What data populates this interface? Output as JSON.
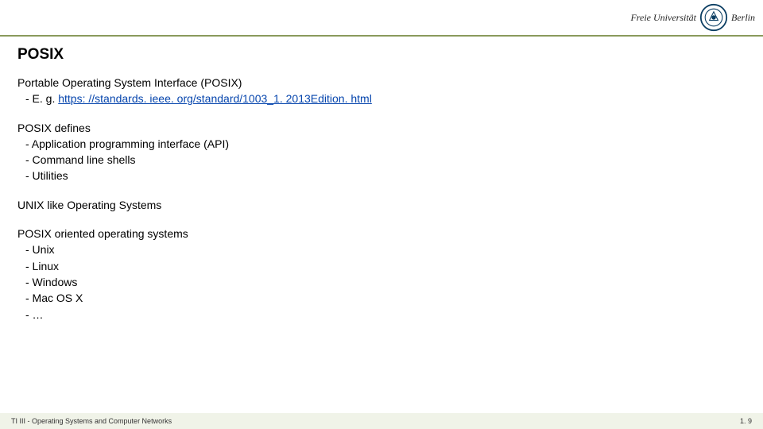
{
  "header": {
    "logo_left": "Freie Universität",
    "logo_right": "Berlin"
  },
  "slide": {
    "title": "POSIX",
    "p1_lead": "Portable Operating System Interface (POSIX)",
    "p1_eg_prefix": "- E. g. ",
    "p1_link": "https: //standards. ieee. org/standard/1003_1. 2013Edition. html",
    "p2_lead": "POSIX defines",
    "p2_items": [
      "- Application programming interface (API)",
      "- Command line shells",
      "- Utilities"
    ],
    "p3_lead": "UNIX like Operating Systems",
    "p4_lead": "POSIX oriented operating systems",
    "p4_items": [
      "- Unix",
      "- Linux",
      "- Windows",
      "- Mac OS X",
      "- …"
    ]
  },
  "footer": {
    "left": "TI III - Operating Systems and Computer Networks",
    "right": "1. 9"
  }
}
